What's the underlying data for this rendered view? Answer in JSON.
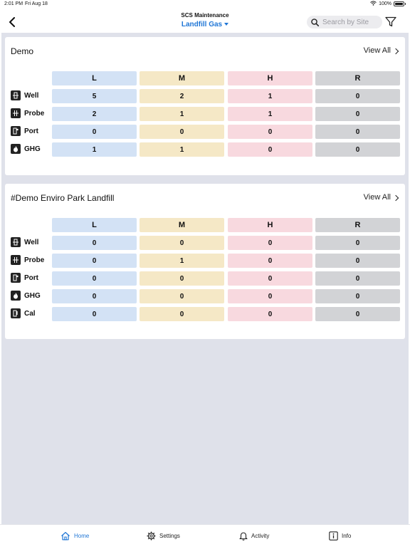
{
  "status_bar": {
    "time": "2:01 PM",
    "date": "Fri Aug 18",
    "battery": "100%"
  },
  "nav": {
    "title": "SCS Maintenance",
    "subtitle": "Landfill Gas",
    "search_placeholder": "Search by Site"
  },
  "columns": [
    "L",
    "M",
    "H",
    "R"
  ],
  "colors": {
    "L": "#d3e2f5",
    "M": "#f5e8c6",
    "H": "#f8d9df",
    "R": "#d2d3d6",
    "accent": "#1f76d6"
  },
  "cards": [
    {
      "title": "Demo",
      "view_all": "View All",
      "rows": [
        {
          "icon": "well-icon",
          "label": "Well",
          "values": [
            "5",
            "2",
            "1",
            "0"
          ]
        },
        {
          "icon": "probe-icon",
          "label": "Probe",
          "values": [
            "2",
            "1",
            "1",
            "0"
          ]
        },
        {
          "icon": "port-icon",
          "label": "Port",
          "values": [
            "0",
            "0",
            "0",
            "0"
          ]
        },
        {
          "icon": "flame-icon",
          "label": "GHG",
          "values": [
            "1",
            "1",
            "0",
            "0"
          ]
        }
      ]
    },
    {
      "title": "#Demo Enviro Park Landfill",
      "view_all": "View All",
      "rows": [
        {
          "icon": "well-icon",
          "label": "Well",
          "values": [
            "0",
            "0",
            "0",
            "0"
          ]
        },
        {
          "icon": "probe-icon",
          "label": "Probe",
          "values": [
            "0",
            "1",
            "0",
            "0"
          ]
        },
        {
          "icon": "port-icon",
          "label": "Port",
          "values": [
            "0",
            "0",
            "0",
            "0"
          ]
        },
        {
          "icon": "flame-icon",
          "label": "GHG",
          "values": [
            "0",
            "0",
            "0",
            "0"
          ]
        },
        {
          "icon": "cal-icon",
          "label": "Cal",
          "values": [
            "0",
            "0",
            "0",
            "0"
          ]
        }
      ]
    }
  ],
  "tabs": [
    {
      "icon": "home-icon",
      "label": "Home",
      "active": true
    },
    {
      "icon": "gear-icon",
      "label": "Settings",
      "active": false
    },
    {
      "icon": "bell-icon",
      "label": "Activity",
      "active": false
    },
    {
      "icon": "info-icon",
      "label": "Info",
      "active": false
    }
  ]
}
